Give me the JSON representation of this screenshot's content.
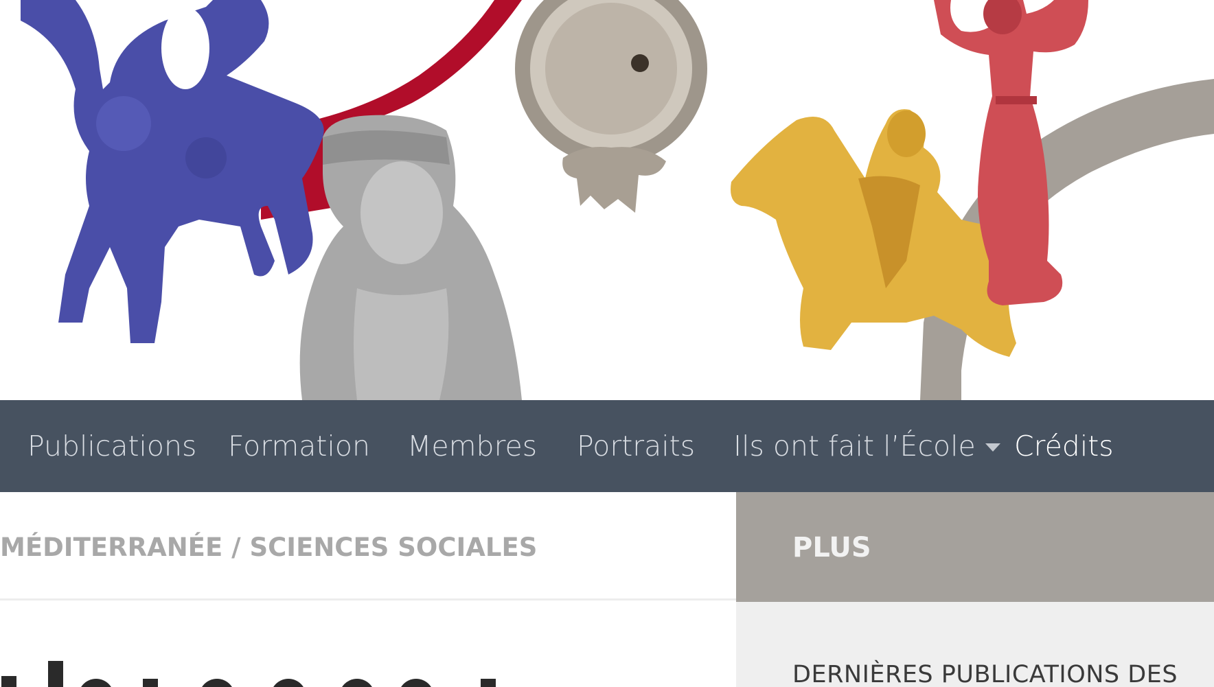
{
  "hero": {
    "figures": [
      "blue-horse-figurine",
      "terracotta-bust",
      "oil-lamp-medallion",
      "yellow-rider-figurine",
      "red-woman-figurine"
    ],
    "colors": {
      "blue": "#4a4ea8",
      "red_arc": "#b10d2a",
      "gray_arc": "#a59f98",
      "gold": "#e2b240",
      "terracotta": "#cf4e55"
    }
  },
  "nav": {
    "items": [
      {
        "label": "Publications"
      },
      {
        "label": "Formation"
      },
      {
        "label": "Membres"
      },
      {
        "label": "Portraits"
      },
      {
        "label": "Ils ont fait l’École"
      },
      {
        "label": "Crédits"
      }
    ],
    "background": "#475260"
  },
  "breadcrumb": {
    "text": "MÉDITERRANÉE / SCIENCES SOCIALES"
  },
  "sidebar": {
    "heading": "PLUS",
    "item": "DERNIÈRES PUBLICATIONS DES"
  }
}
